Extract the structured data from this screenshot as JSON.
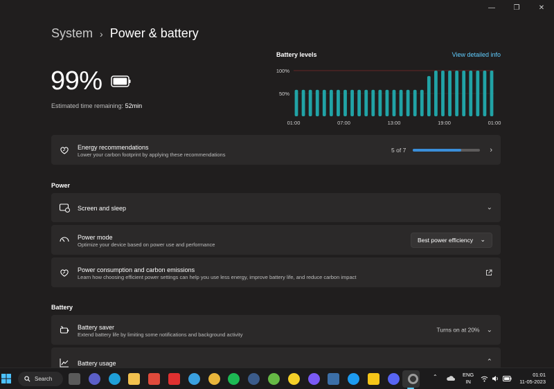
{
  "window": {
    "minimize": "—",
    "maximize": "❐",
    "close": "✕"
  },
  "breadcrumb": {
    "parent": "System",
    "separator": "›",
    "current": "Power & battery"
  },
  "battery": {
    "percent": "99%",
    "estimate_label": "Estimated time remaining:",
    "estimate_value": "52min",
    "charge_level": 0.99
  },
  "chart_data": {
    "type": "bar",
    "title": "Battery levels",
    "link": "View detailed info",
    "y_ticks": [
      "100%",
      "50%"
    ],
    "x_ticks": [
      "01:00",
      "07:00",
      "13:00",
      "19:00",
      "01:00"
    ],
    "ylim": [
      0,
      100
    ],
    "values": [
      58,
      58,
      58,
      58,
      58,
      58,
      58,
      58,
      58,
      58,
      58,
      58,
      58,
      58,
      58,
      58,
      58,
      58,
      58,
      88,
      100,
      100,
      100,
      100,
      100,
      100,
      100,
      100,
      100
    ]
  },
  "energy": {
    "title": "Energy recommendations",
    "subtitle": "Lower your carbon footprint by applying these recommendations",
    "progress_text": "5 of 7",
    "progress": 0.714
  },
  "sections": {
    "power": "Power",
    "battery": "Battery"
  },
  "screen_sleep": {
    "title": "Screen and sleep"
  },
  "power_mode": {
    "title": "Power mode",
    "subtitle": "Optimize your device based on power use and performance",
    "selected": "Best power efficiency"
  },
  "consumption": {
    "title": "Power consumption and carbon emissions",
    "subtitle": "Learn how choosing efficient power settings can help you use less energy, improve battery life, and reduce carbon impact"
  },
  "battery_saver": {
    "title": "Battery saver",
    "subtitle": "Extend battery life by limiting some notifications and background activity",
    "status": "Turns on at 20%"
  },
  "battery_usage": {
    "title": "Battery usage"
  },
  "taskbar": {
    "search": "Search",
    "lang_top": "ENG",
    "lang_bottom": "IN",
    "time": "01:01",
    "date": "11-05-2023",
    "apps": [
      {
        "name": "file-explorer-icon",
        "color": "#5a5a5a"
      },
      {
        "name": "meet-icon",
        "color": "#5b5fc7"
      },
      {
        "name": "edge-icon",
        "color": "#1f9fd8"
      },
      {
        "name": "folder-icon",
        "color": "#f2c14e"
      },
      {
        "name": "store-icon",
        "color": "#e04a3b"
      },
      {
        "name": "diamond-app-icon",
        "color": "#e03030"
      },
      {
        "name": "help-icon",
        "color": "#3aa0e0"
      },
      {
        "name": "chrome-icon",
        "color": "#e9b53b"
      },
      {
        "name": "spotify-icon",
        "color": "#1db954"
      },
      {
        "name": "steam-icon",
        "color": "#3b5b8a"
      },
      {
        "name": "torrent-icon",
        "color": "#66b845"
      },
      {
        "name": "norton-icon",
        "color": "#f5d028"
      },
      {
        "name": "vpn-icon",
        "color": "#7a5af5"
      },
      {
        "name": "notes-icon",
        "color": "#3c6fa8"
      },
      {
        "name": "twitter-icon",
        "color": "#1d9bf0"
      },
      {
        "name": "sticky-notes-icon",
        "color": "#f5c518"
      },
      {
        "name": "discord-icon",
        "color": "#5865f2"
      },
      {
        "name": "settings-icon",
        "color": "#8a8a8a"
      }
    ]
  }
}
